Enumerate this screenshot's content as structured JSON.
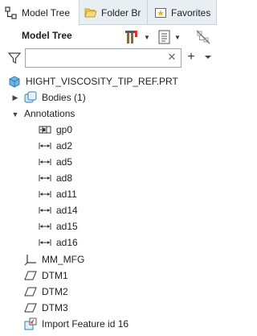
{
  "tabs": [
    {
      "label": "Model Tree"
    },
    {
      "label": "Folder Br"
    },
    {
      "label": "Favorites"
    }
  ],
  "panel": {
    "title": "Model Tree"
  },
  "search": {
    "value": "",
    "placeholder": ""
  },
  "tree": {
    "root": "HIGHT_VISCOSITY_TIP_REF.PRT",
    "bodies": "Bodies (1)",
    "annotations": "Annotations",
    "annotation_items": [
      "gp0",
      "ad2",
      "ad5",
      "ad8",
      "ad11",
      "ad14",
      "ad15",
      "ad16"
    ],
    "features": [
      "MM_MFG",
      "DTM1",
      "DTM2",
      "DTM3",
      "Import Feature id 16"
    ]
  }
}
